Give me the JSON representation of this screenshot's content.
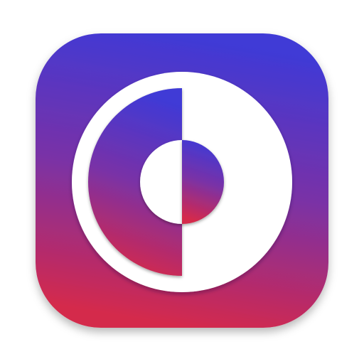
{
  "app_icon": {
    "icon": "half-circle-ring-icon",
    "colors": {
      "gradient_top": "#3f3ad6",
      "gradient_mid": "#7a31a6",
      "gradient_bottom": "#d4294c",
      "symbol": "#ffffff"
    }
  }
}
